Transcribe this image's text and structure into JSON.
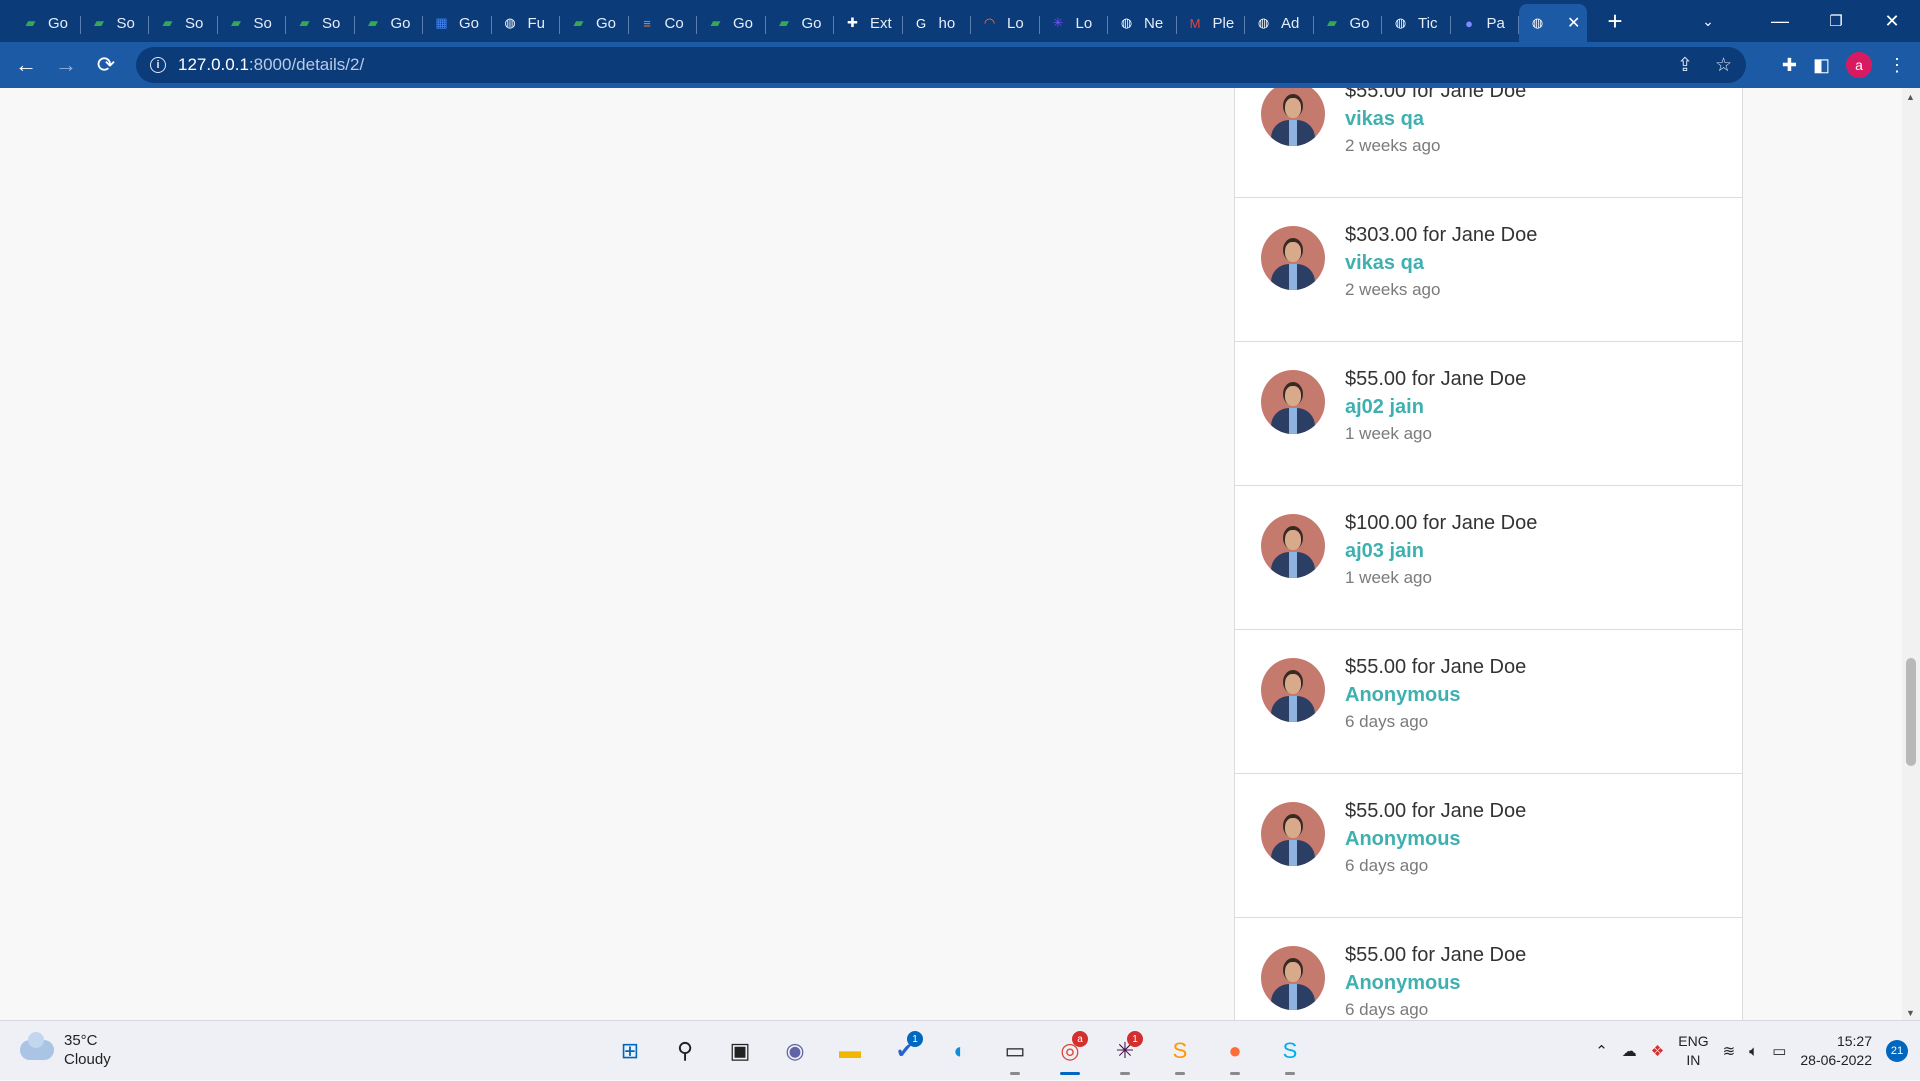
{
  "browser": {
    "tabs": [
      {
        "label": "Go",
        "icon": "meet-icon",
        "color": "#34a853"
      },
      {
        "label": "So",
        "icon": "meet-icon",
        "color": "#34a853"
      },
      {
        "label": "So",
        "icon": "meet-icon",
        "color": "#34a853"
      },
      {
        "label": "So",
        "icon": "meet-icon",
        "color": "#34a853"
      },
      {
        "label": "So",
        "icon": "meet-icon",
        "color": "#34a853"
      },
      {
        "label": "Go",
        "icon": "meet-icon",
        "color": "#34a853"
      },
      {
        "label": "Go",
        "icon": "calendar-icon",
        "color": "#4285f4"
      },
      {
        "label": "Fu",
        "icon": "globe-icon",
        "color": "#ffffff"
      },
      {
        "label": "Go",
        "icon": "meet-icon",
        "color": "#34a853"
      },
      {
        "label": "Co",
        "icon": "stackoverflow-icon",
        "color": "#f48024"
      },
      {
        "label": "Go",
        "icon": "meet-icon",
        "color": "#34a853"
      },
      {
        "label": "Go",
        "icon": "meet-icon",
        "color": "#34a853"
      },
      {
        "label": "Ext",
        "icon": "puzzle-icon",
        "color": "#ffffff"
      },
      {
        "label": "ho",
        "icon": "google-icon",
        "color": "#ffffff"
      },
      {
        "label": "Lo",
        "icon": "rainbow-icon",
        "color": "#ff7043"
      },
      {
        "label": "Lo",
        "icon": "star-burst-icon",
        "color": "#7c4dff"
      },
      {
        "label": "Ne",
        "icon": "globe-icon",
        "color": "#ffffff"
      },
      {
        "label": "Ple",
        "icon": "gmail-icon",
        "color": "#ea4335"
      },
      {
        "label": "Ad",
        "icon": "globe-icon",
        "color": "#ffffff"
      },
      {
        "label": "Go",
        "icon": "meet-icon",
        "color": "#34a853"
      },
      {
        "label": "Tic",
        "icon": "globe-icon",
        "color": "#ffffff"
      },
      {
        "label": "Pa",
        "icon": "dot-icon",
        "color": "#7e8cff"
      }
    ],
    "active_tab_icon": "globe-icon",
    "new_tab_label": "+",
    "url_host": "127.0.0.1",
    "url_path": ":8000/details/2/",
    "profile_initial": "a"
  },
  "donations": [
    {
      "amount_text": "$55.00 for Jane Doe",
      "donor": "vikas qa",
      "time": "2 weeks ago"
    },
    {
      "amount_text": "$303.00 for Jane Doe",
      "donor": "vikas qa",
      "time": "2 weeks ago"
    },
    {
      "amount_text": "$55.00 for Jane Doe",
      "donor": "aj02 jain",
      "time": "1 week ago"
    },
    {
      "amount_text": "$100.00 for Jane Doe",
      "donor": "aj03 jain",
      "time": "1 week ago"
    },
    {
      "amount_text": "$55.00 for Jane Doe",
      "donor": "Anonymous",
      "time": "6 days ago"
    },
    {
      "amount_text": "$55.00 for Jane Doe",
      "donor": "Anonymous",
      "time": "6 days ago"
    },
    {
      "amount_text": "$55.00 for Jane Doe",
      "donor": "Anonymous",
      "time": "6 days ago"
    }
  ],
  "taskbar": {
    "weather_temp": "35°C",
    "weather_desc": "Cloudy",
    "apps": [
      {
        "name": "start-icon",
        "glyph": "⊞",
        "color": "#0067c0"
      },
      {
        "name": "search-icon",
        "glyph": "⚲",
        "color": "#222222"
      },
      {
        "name": "task-view-icon",
        "glyph": "▣",
        "color": "#222222"
      },
      {
        "name": "chat-icon",
        "glyph": "◉",
        "color": "#6264a7"
      },
      {
        "name": "file-explorer-icon",
        "glyph": "▬",
        "color": "#f2b600"
      },
      {
        "name": "todo-icon",
        "glyph": "✔",
        "color": "#2564cf",
        "badge": "1"
      },
      {
        "name": "edge-icon",
        "glyph": "◐",
        "color": "#0c8ed9"
      },
      {
        "name": "terminal-icon",
        "glyph": "▭",
        "color": "#222222"
      },
      {
        "name": "chrome-icon",
        "glyph": "◎",
        "color": "#db4437",
        "badge": "a",
        "badge_red": true,
        "active": true
      },
      {
        "name": "slack-icon",
        "glyph": "✳",
        "color": "#4a154b",
        "badge": "1",
        "badge_red": true
      },
      {
        "name": "sublime-icon",
        "glyph": "S",
        "color": "#ff9800"
      },
      {
        "name": "postman-icon",
        "glyph": "●",
        "color": "#ff6c37"
      },
      {
        "name": "skype-icon",
        "glyph": "S",
        "color": "#00aff0"
      }
    ],
    "lang_line1": "ENG",
    "lang_line2": "IN",
    "time": "15:27",
    "date": "28-06-2022",
    "notifications": "21"
  }
}
